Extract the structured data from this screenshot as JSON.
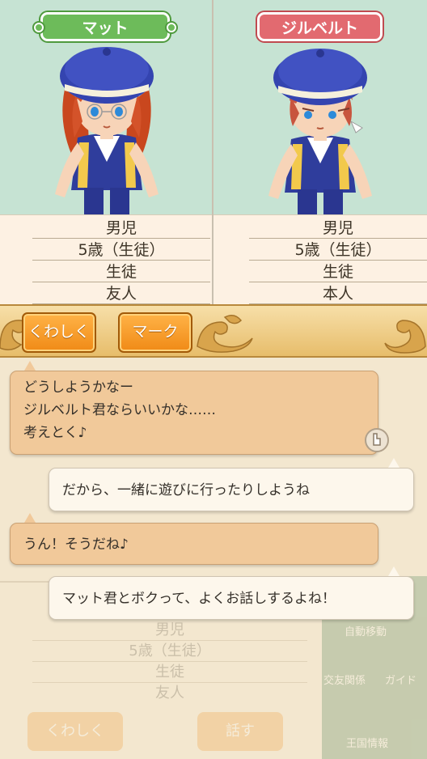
{
  "characters": [
    {
      "name": "マット",
      "name_plate_color": "#6dbb5a",
      "info": [
        "男児",
        "5歳（生徒）",
        "生徒",
        "友人"
      ]
    },
    {
      "name": "ジルベルト",
      "name_plate_color": "#e26a70",
      "info": [
        "男児",
        "5歳（生徒）",
        "生徒",
        "本人"
      ]
    }
  ],
  "actions": {
    "details_label": "くわしく",
    "mark_label": "マーク"
  },
  "messages": [
    {
      "speaker": "matt",
      "text_lines": [
        "どうしようかなー",
        "ジルベルト君ならいいかな……",
        "考えとく♪"
      ]
    },
    {
      "speaker": "gilbert",
      "text_lines": [
        "だから、一緒に遊びに行ったりしようね"
      ]
    },
    {
      "speaker": "matt",
      "text_lines": [
        "うん！そうだね♪"
      ]
    },
    {
      "speaker": "gilbert",
      "text_lines": [
        "マット君とボクって、よくお話しするよね！"
      ]
    }
  ],
  "background_panel": {
    "info": [
      "男児",
      "5歳（生徒）",
      "生徒",
      "友人"
    ],
    "details_label": "くわしく",
    "talk_label": "話す",
    "menu": [
      "自動移動",
      "交友関係",
      "ガイド",
      "王国情報"
    ]
  },
  "colors": {
    "portrait_bg": "#c6e3d3",
    "info_bg": "#fdf1e3",
    "button_orange": "#f08a16",
    "bubble_tan": "#f1c99a",
    "bubble_white": "#fdf7ec"
  }
}
